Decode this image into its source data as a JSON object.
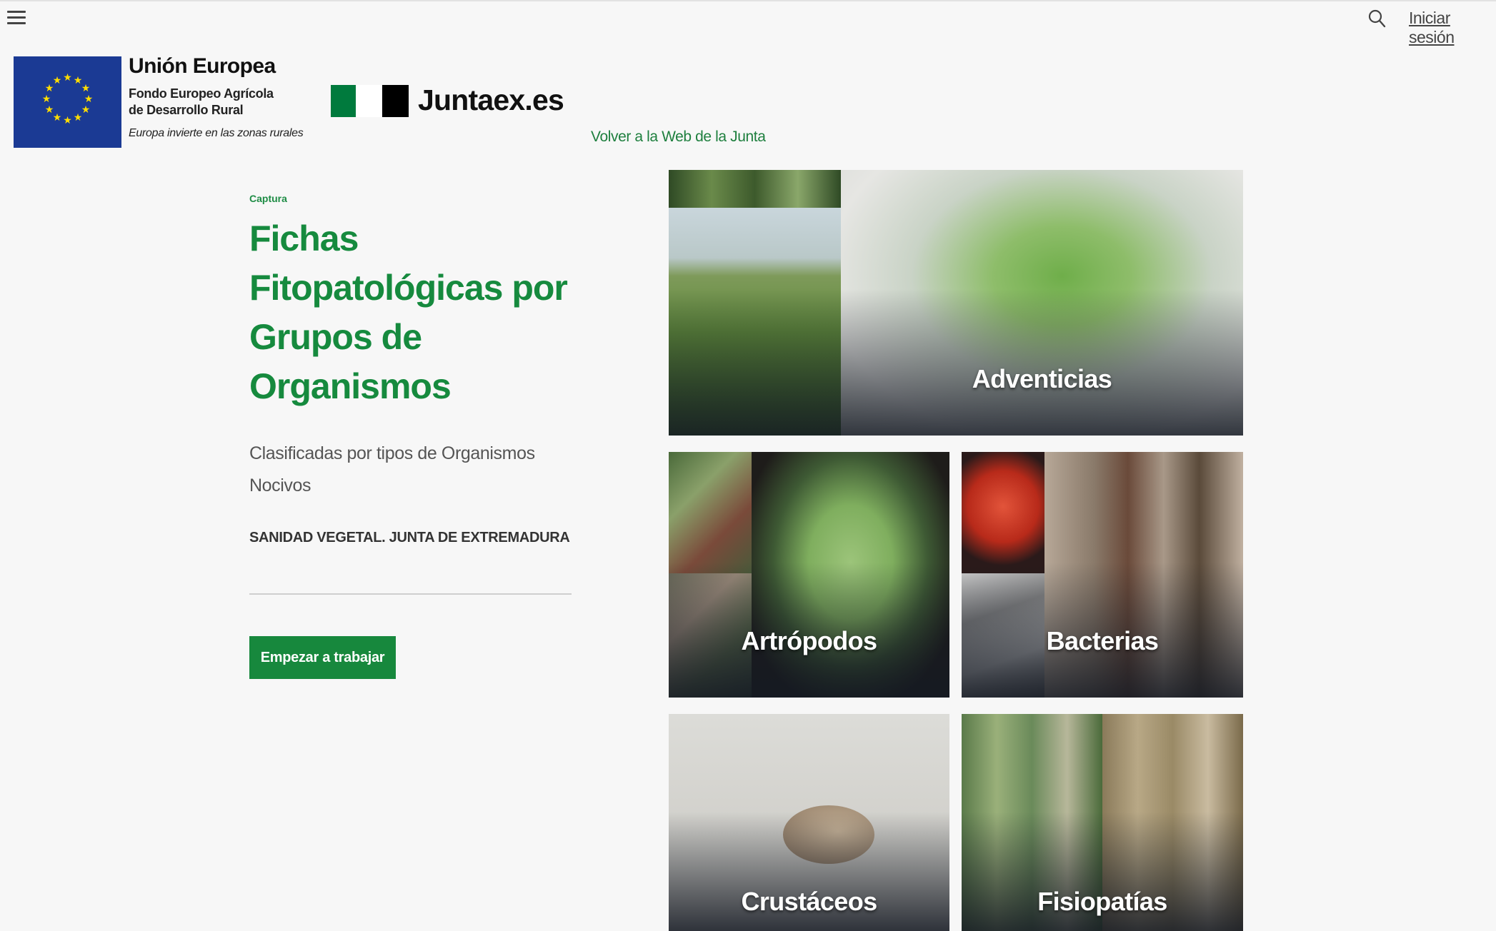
{
  "topbar": {
    "login_label": "Iniciar sesión"
  },
  "logos": {
    "eu_title": "Unión Europea",
    "eu_fund_line1": "Fondo Europeo Agrícola",
    "eu_fund_line2": "de Desarrollo Rural",
    "eu_motto": "Europa invierte en las zonas rurales",
    "junta_name": "Juntaex.es",
    "junta_colors": [
      "#007a3d",
      "#ffffff",
      "#000000"
    ],
    "eu_flag_color": "#1b3a94",
    "eu_star_color": "#ffdd00"
  },
  "back_link": "Volver a la Web de la Junta",
  "hero": {
    "eyebrow": "Captura",
    "title": "Fichas Fitopatológicas por Grupos de Organismos",
    "subtitle": "Clasificadas por tipos de Organismos Nocivos",
    "organization": "SANIDAD VEGETAL. JUNTA DE EXTREMADURA",
    "button_label": "Empezar a trabajar"
  },
  "cards": [
    {
      "label": "Adventicias"
    },
    {
      "label": "Artrópodos"
    },
    {
      "label": "Bacterias"
    },
    {
      "label": "Crustáceos"
    },
    {
      "label": "Fisiopatías"
    }
  ],
  "colors": {
    "accent": "#168a3e",
    "button": "#17883d",
    "background": "#f7f7f7"
  }
}
